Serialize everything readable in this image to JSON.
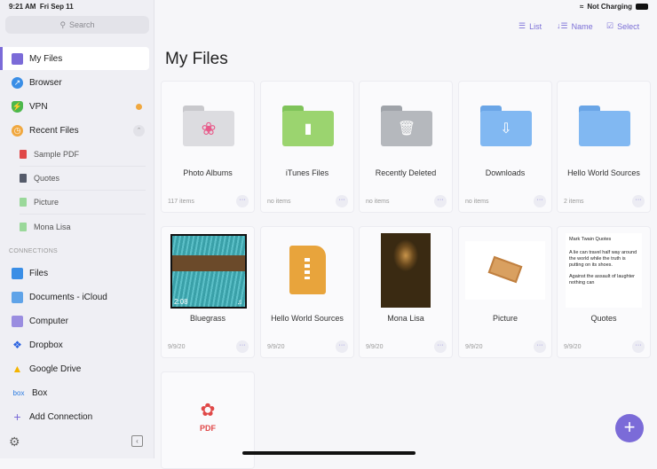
{
  "status": {
    "time": "9:21 AM",
    "date": "Fri Sep 11",
    "battery": "Not Charging"
  },
  "sidebar": {
    "search_placeholder": "Search",
    "items": [
      {
        "label": "My Files",
        "color": "#7b6bd8"
      },
      {
        "label": "Browser",
        "color": "#3a8ee6"
      },
      {
        "label": "VPN",
        "color": "#4cb84c"
      },
      {
        "label": "Recent Files",
        "color": "#f0a840"
      }
    ],
    "recent": [
      "Sample PDF",
      "Quotes",
      "Picture",
      "Mona Lisa"
    ],
    "connections_header": "CONNECTIONS",
    "connections": [
      "Files",
      "Documents - iCloud",
      "Computer",
      "Dropbox",
      "Google Drive",
      "Box",
      "Add Connection"
    ]
  },
  "toolbar": {
    "list": "List",
    "name": "Name",
    "select": "Select"
  },
  "main": {
    "title": "My Files",
    "row1": [
      {
        "name": "Photo Albums",
        "meta": "117 items"
      },
      {
        "name": "iTunes Files",
        "meta": "no items"
      },
      {
        "name": "Recently Deleted",
        "meta": "no items"
      },
      {
        "name": "Downloads",
        "meta": "no items"
      },
      {
        "name": "Hello World Sources",
        "meta": "2 items"
      }
    ],
    "row2": [
      {
        "name": "Bluegrass",
        "meta": "9/9/20",
        "duration": "2:08"
      },
      {
        "name": "Hello World Sources",
        "meta": "9/9/20"
      },
      {
        "name": "Mona Lisa",
        "meta": "9/9/20"
      },
      {
        "name": "Picture",
        "meta": "9/9/20"
      },
      {
        "name": "Quotes",
        "meta": "9/9/20",
        "preview_title": "Mark Twain Quotes",
        "preview_text1": "A lie can travel half way around the world while the truth is putting on its shoes.",
        "preview_text2": "Against the assault of laughter nothing can"
      }
    ],
    "pdf_label": "PDF"
  }
}
